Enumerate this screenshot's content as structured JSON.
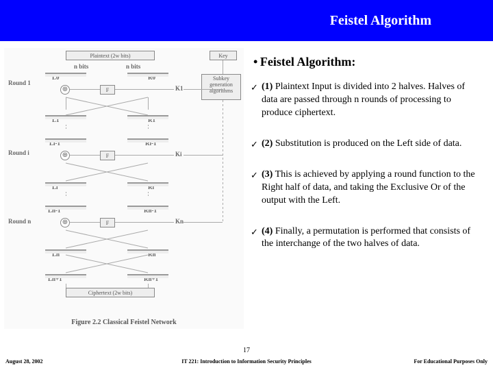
{
  "title": "Feistel Algorithm",
  "heading_bullet": "• ",
  "heading": "Feistel Algorithm:",
  "points": [
    {
      "num": "(1)",
      "text": " Plaintext Input is divided into 2 halves. Halves of data are passed through n rounds of processing to produce ciphertext."
    },
    {
      "num": "(2)",
      "text": " Substitution is produced on the Left side of data."
    },
    {
      "num": "(3)",
      "text": " This is achieved by applying a round function to the Right half of data, and taking the Exclusive Or of the output with the Left."
    },
    {
      "num": "(4)",
      "text": " Finally, a permutation is performed that consists of the interchange of the two halves of data."
    }
  ],
  "diagram": {
    "header_l": "Plaintext (2w bits)",
    "header_nl": "n bits",
    "header_nr": "n bits",
    "key_label": "Key",
    "subkey_box": "Subkey generation algorithms",
    "rounds": [
      "Round 1",
      "Round i",
      "Round n"
    ],
    "L": [
      "L0",
      "L1",
      "Li-1",
      "Li",
      "Ln-1",
      "Ln",
      "Ln+1"
    ],
    "R": [
      "R0",
      "R1",
      "Ri-1",
      "Ri",
      "Rn-1",
      "Rn",
      "Rn+1"
    ],
    "K": [
      "K1",
      "Ki",
      "Kn"
    ],
    "F": "F",
    "xor": "⊕",
    "cipher": "Ciphertext (2w bits)",
    "caption": "Figure 2.2  Classical Feistel Network"
  },
  "footer": {
    "page": "17",
    "date": "August 28, 2002",
    "course": "IT 221: Introduction to Information Security Principles",
    "right": "For Educational Purposes Only"
  }
}
